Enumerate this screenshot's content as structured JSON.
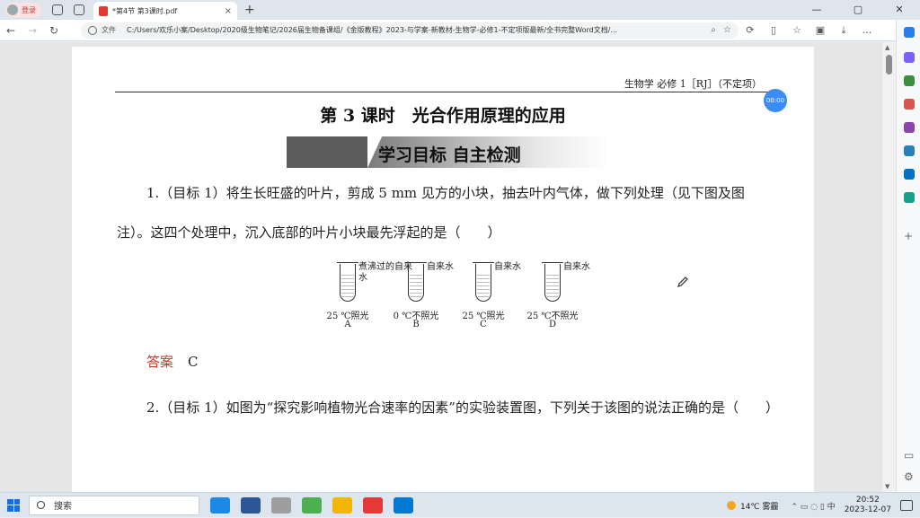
{
  "browser": {
    "login_label": "登录",
    "tab_title": "*第4节 第3课时.pdf",
    "tab_close": "×",
    "new_tab": "+",
    "window_controls": [
      "—",
      "▢",
      "✕"
    ],
    "address": {
      "file_label": "文件",
      "url": "C:/Users/欢乐小案/Desktop/2020级生物笔记/2026届生物备课组/《金版教程》2023-与学案-新教材-生物学-必修1-不定项版最新/全书完整Word文档/..."
    }
  },
  "document": {
    "running_header": "生物学 必修 1［RJ］（不定项）",
    "lesson_title": "第 3 课时　光合作用原理的应用",
    "section_banner": "学习目标 自主检测",
    "question1": "1.（目标 1）将生长旺盛的叶片，剪成 5 mm 见方的小块，抽去叶内气体，做下列处理（见下图及图注）。这四个处理中，沉入底部的叶片小块最先浮起的是（　　）",
    "figure": {
      "tubes": [
        {
          "label": "煮沸过的自来水",
          "condition": "25 ℃照光",
          "letter": "A"
        },
        {
          "label": "自来水",
          "condition": "0 ℃不照光",
          "letter": "B"
        },
        {
          "label": "自来水",
          "condition": "25 ℃照光",
          "letter": "C"
        },
        {
          "label": "自来水",
          "condition": "25 ℃不照光",
          "letter": "D"
        }
      ]
    },
    "answer_label": "答案",
    "answer_value": "C",
    "question2": "2.（目标 1）如图为“探究影响植物光合速率的因素”的实验装置图，下列关于该图的说法正确的是（　　）"
  },
  "timer": "00:00",
  "taskbar": {
    "search_placeholder": "搜索",
    "weather": "14℃ 雾霾",
    "time": "20:52",
    "date": "2023-12-07"
  },
  "colors": {
    "answer_red": "#c0392b",
    "timer_blue": "#3b8cf5",
    "accent": "#1a6ed8"
  }
}
